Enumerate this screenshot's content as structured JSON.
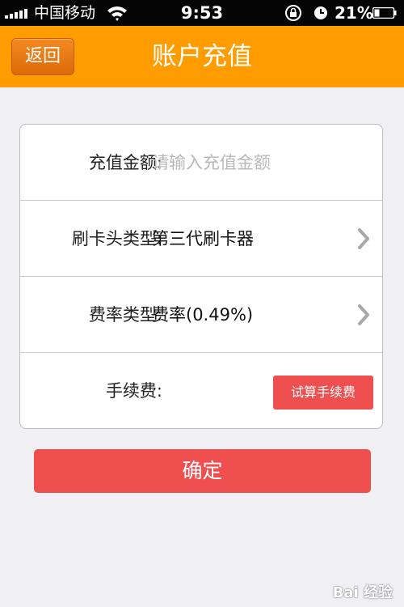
{
  "status_bar": {
    "carrier": "中国移动",
    "time": "9:53",
    "battery": "21%"
  },
  "nav": {
    "back_label": "返回",
    "title": "账户充值"
  },
  "form": {
    "amount": {
      "label": "充值金额:",
      "placeholder": "请输入充值金额"
    },
    "card_reader": {
      "label": "刷卡头类型:",
      "value": "第三代刷卡器"
    },
    "rate_type": {
      "label": "费率类型:",
      "value": "费率(0.49%)"
    },
    "fee": {
      "label": "手续费:",
      "button": "试算手续费"
    }
  },
  "confirm_label": "确定",
  "watermark": "Bai 经验",
  "colors": {
    "accent": "#ff9c00",
    "back_button": "#e87812",
    "primary_button": "#ef4f4f"
  }
}
